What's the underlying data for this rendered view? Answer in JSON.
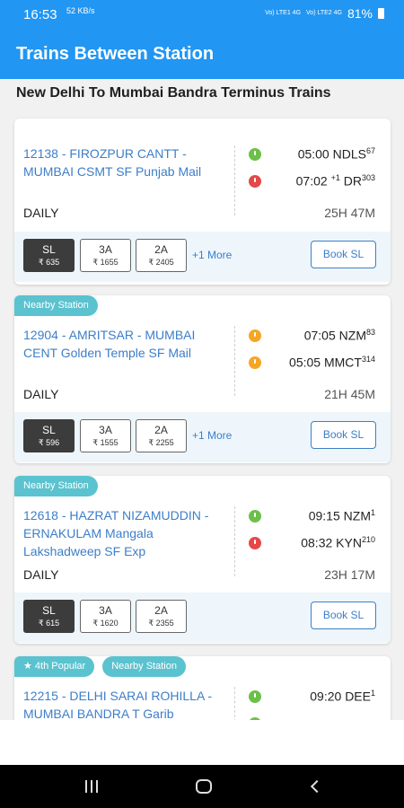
{
  "status_bar": {
    "time": "16:53",
    "extra_icon_text": "52 KB/s",
    "network_1": "Vo) LTE1 4G",
    "network_2": "Vo) LTE2 4G",
    "battery": "81%"
  },
  "app_bar": {
    "title": "Trains Between Station"
  },
  "route_heading": "New Delhi To Mumbai Bandra Terminus Trains",
  "trains": [
    {
      "badges": [],
      "name": "12138 - FIROZPUR CANTT - MUMBAI CSMT SF Punjab Mail",
      "departure": {
        "time": "05:00",
        "station": "NDLS",
        "distance": "67",
        "status": "green"
      },
      "arrival": {
        "time": "07:02",
        "day_offset": "+1",
        "station": "DR",
        "distance": "303",
        "status": "red"
      },
      "frequency": "DAILY",
      "duration": "25H 47M",
      "classes": [
        {
          "code": "SL",
          "fare": "₹ 635",
          "selected": true
        },
        {
          "code": "3A",
          "fare": "₹ 1655",
          "selected": false
        },
        {
          "code": "2A",
          "fare": "₹ 2405",
          "selected": false
        }
      ],
      "more_label": "+1 More",
      "book_label": "Book SL"
    },
    {
      "badges": [
        "Nearby Station"
      ],
      "name": "12904 - AMRITSAR - MUMBAI CENT Golden Temple SF Mail",
      "departure": {
        "time": "07:05",
        "station": "NZM",
        "distance": "83",
        "status": "orange"
      },
      "arrival": {
        "time": "05:05",
        "day_offset": "",
        "station": "MMCT",
        "distance": "314",
        "status": "orange"
      },
      "frequency": "DAILY",
      "duration": "21H 45M",
      "classes": [
        {
          "code": "SL",
          "fare": "₹ 596",
          "selected": true
        },
        {
          "code": "3A",
          "fare": "₹ 1555",
          "selected": false
        },
        {
          "code": "2A",
          "fare": "₹ 2255",
          "selected": false
        }
      ],
      "more_label": "+1 More",
      "book_label": "Book SL"
    },
    {
      "badges": [
        "Nearby Station"
      ],
      "name": "12618 - HAZRAT NIZAMUDDIN - ERNAKULAM Mangala Lakshadweep SF Exp",
      "departure": {
        "time": "09:15",
        "station": "NZM",
        "distance": "1",
        "status": "green"
      },
      "arrival": {
        "time": "08:32",
        "day_offset": "",
        "station": "KYN",
        "distance": "210",
        "status": "red"
      },
      "frequency": "DAILY",
      "duration": "23H 17M",
      "classes": [
        {
          "code": "SL",
          "fare": "₹ 615",
          "selected": true
        },
        {
          "code": "3A",
          "fare": "₹ 1620",
          "selected": false
        },
        {
          "code": "2A",
          "fare": "₹ 2355",
          "selected": false
        }
      ],
      "more_label": "",
      "book_label": "Book SL"
    },
    {
      "badges": [
        "★ 4th Popular",
        "Nearby Station"
      ],
      "name": "12215 - DELHI SARAI ROHILLA - MUMBAI BANDRA T Garib",
      "departure": {
        "time": "09:20",
        "station": "DEE",
        "distance": "1",
        "status": "green"
      },
      "frequency": "",
      "duration": "",
      "classes": [],
      "more_label": "",
      "book_label": ""
    }
  ],
  "colors": {
    "primary": "#2196f3",
    "link": "#3d7ec8",
    "badge": "#5bc2cf",
    "class_bar": "#eef6fb",
    "selected_chip": "#3c3c3c",
    "status_green": "#6cc04a",
    "status_red": "#e54848",
    "status_orange": "#f5a623"
  },
  "nav_bar": {
    "icons": [
      "recents-icon",
      "home-icon",
      "back-icon"
    ]
  }
}
